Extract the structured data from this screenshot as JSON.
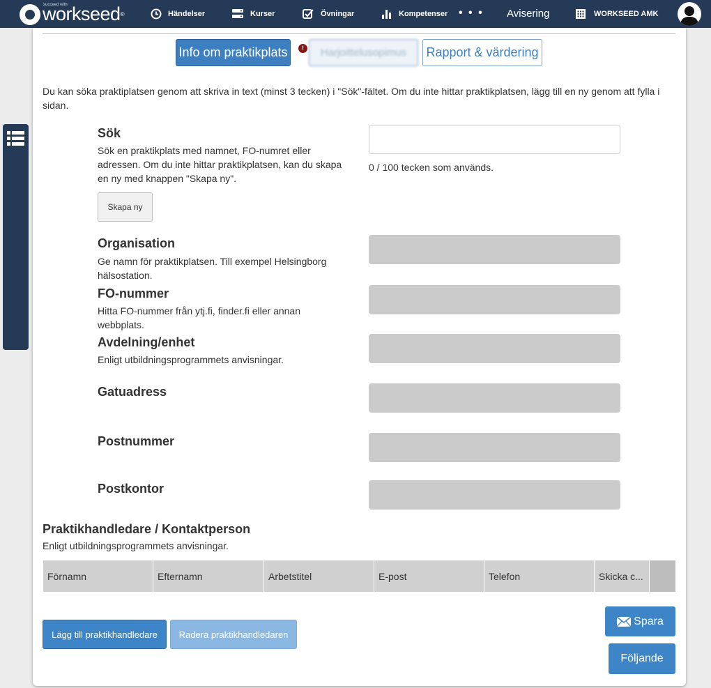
{
  "brand": {
    "tagline": "succeed with",
    "name": "workseed",
    "mark": "®"
  },
  "nav": {
    "items": [
      {
        "label": "Händelser",
        "icon": "clock-icon"
      },
      {
        "label": "Kurser",
        "icon": "server-icon"
      },
      {
        "label": "Övningar",
        "icon": "checkbox-icon"
      },
      {
        "label": "Kompetenser",
        "icon": "bar-chart-icon"
      }
    ],
    "more": "• • •",
    "avisering": "Avisering",
    "org": "WORKSEED AMK"
  },
  "tabs": {
    "info": "Info om praktikplats",
    "blurred": "Harjoittelusopimus",
    "rapport": "Rapport & värdering",
    "warning": "!"
  },
  "intro": "Du kan söka praktiplatsen genom att skriva in text (minst 3 tecken) i \"Sök\"-fältet. Om du inte hittar praktikplatsen, lägg till en ny genom att fylla i sidan.",
  "search": {
    "label": "Sök",
    "desc": "Sök en praktikplats med namnet, FO-numret eller adressen. Om du inte hittar praktikplatsen, kan du skapa en ny med knappen \"Skapa ny\".",
    "value": "",
    "counter": "0 / 100 tecken som används.",
    "create_button": "Skapa ny"
  },
  "fields": {
    "organisation": {
      "label": "Organisation",
      "desc": "Ge namn för praktikplatsen. Till exempel Helsingborg hälsostation."
    },
    "fo": {
      "label": "FO-nummer",
      "desc": "Hitta FO-nummer från ytj.fi, finder.fi eller annan webbplats."
    },
    "avdelning": {
      "label": "Avdelning/enhet",
      "desc": "Enligt utbildningsprogrammets anvisningar."
    },
    "gatuadress": {
      "label": "Gatuadress"
    },
    "postnummer": {
      "label": "Postnummer"
    },
    "postkontor": {
      "label": "Postkontor"
    }
  },
  "contacts": {
    "title": "Praktikhandledare / Kontaktperson",
    "sub": "Enligt utbildningsprogrammets anvisningar.",
    "columns": [
      "Förnamn",
      "Efternamn",
      "Arbetstitel",
      "E-post",
      "Telefon",
      "Skicka c..."
    ]
  },
  "buttons": {
    "add": "Lägg till praktikhandledare",
    "delete": "Radera praktikhandledaren",
    "save": "Spara",
    "next": "Följande"
  },
  "colors": {
    "nav_bg": "#253a57",
    "primary": "#3d85c6",
    "field_disabled": "#cbcbcb"
  }
}
